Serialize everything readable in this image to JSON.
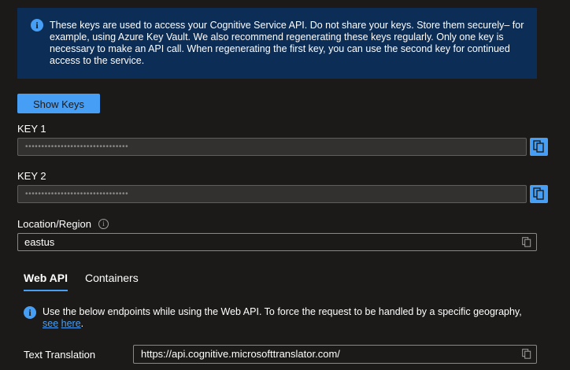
{
  "info_banner": {
    "icon": "info-icon",
    "text": "These keys are used to access your Cognitive Service API. Do not share your keys. Store them securely– for example, using Azure Key Vault. We also recommend regenerating these keys regularly. Only one key is necessary to make an API call. When regenerating the first key, you can use the second key for continued access to the service."
  },
  "show_keys_button": "Show Keys",
  "key1": {
    "label": "KEY 1",
    "value": "••••••••••••••••••••••••••••••••"
  },
  "key2": {
    "label": "KEY 2",
    "value": "••••••••••••••••••••••••••••••••"
  },
  "location": {
    "label": "Location/Region",
    "value": "eastus"
  },
  "tabs": [
    {
      "label": "Web API",
      "selected": true
    },
    {
      "label": "Containers",
      "selected": false
    }
  ],
  "endpoint_info": {
    "text": "Use the below endpoints while using the Web API. To force the request to be handled by a specific geography,",
    "link_see": "see",
    "link_here": "here",
    "trailing": "."
  },
  "text_translation": {
    "label": "Text Translation",
    "value": "https://api.cognitive.microsofttranslator.com/"
  },
  "colors": {
    "background": "#1b1a19",
    "accent": "#479ef5",
    "banner": "#0c2d56",
    "field_background": "#323130"
  }
}
